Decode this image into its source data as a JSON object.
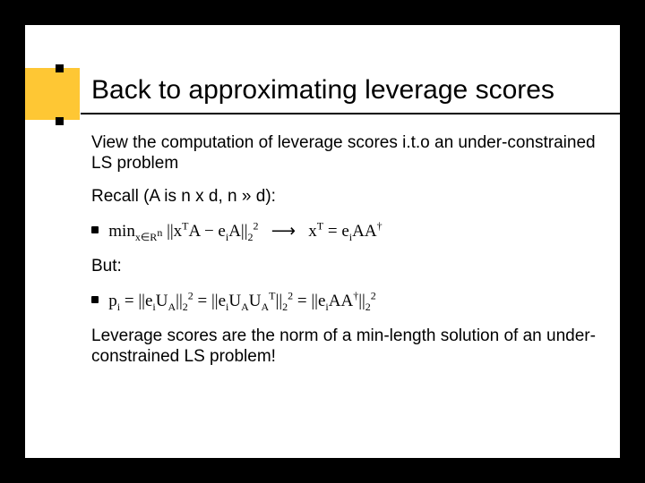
{
  "title": "Back to approximating leverage scores",
  "p1": "View the computation of leverage scores i.t.o an under-constrained LS problem",
  "p2": "Recall (A is n x d, n » d):",
  "formula1": "min_{x∈Rⁿ} ||xᵀA − eᵢA||₂²   →   xᵀ = eᵢAA†",
  "p3": "But:",
  "formula2": "pᵢ = ||eᵢUₐ||₂² = ||eᵢUₐUₐᵀ||₂² = ||eᵢAA†||₂²",
  "p4": "Leverage scores are the norm of a min-length solution of an under-constrained LS problem!"
}
